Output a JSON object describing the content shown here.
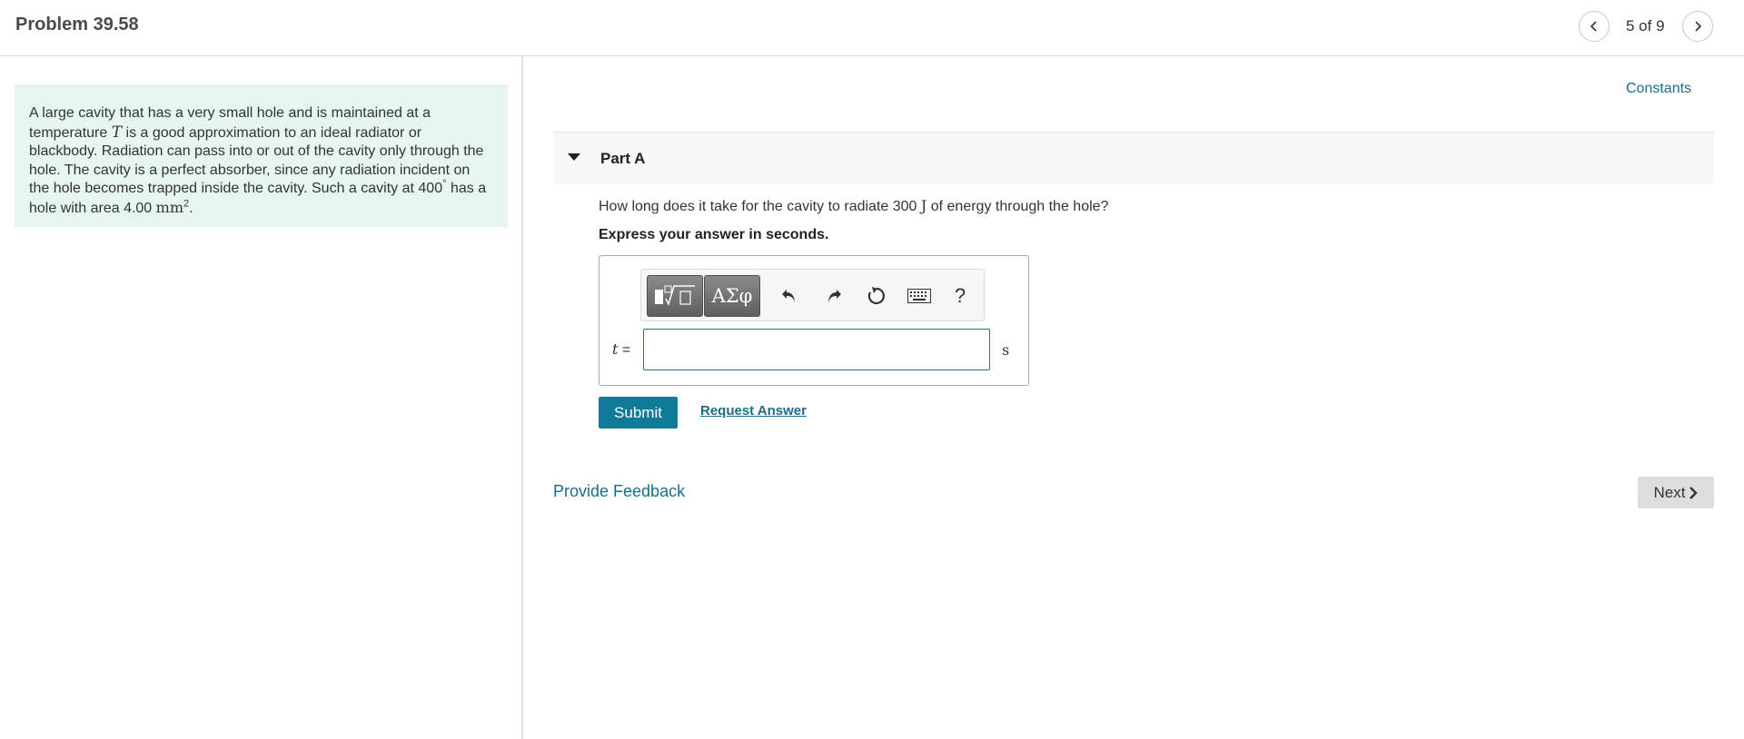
{
  "header": {
    "title": "Problem 39.58",
    "page_counter": "5 of 9",
    "prev_icon": "chevron-left-icon",
    "next_icon": "chevron-right-icon"
  },
  "intro": {
    "text_1": "A large cavity that has a very small hole and is maintained at a temperature ",
    "var_T": "T",
    "text_2": " is a good approximation to an ideal radiator or blackbody. Radiation can pass into or out of the cavity only through the hole. The cavity is a perfect absorber, since any radiation incident on the hole becomes trapped inside the cavity. Such a cavity at 400",
    "degree": "°",
    "text_3": " has a hole with area 4.00 ",
    "area_unit": "mm",
    "area_exp": "2",
    "text_4": "."
  },
  "constants_link": "Constants",
  "part": {
    "title": "Part A",
    "question_1": "How long does it take for the cavity to radiate 300 ",
    "question_unit": "J",
    "question_2": " of energy through the hole?",
    "instruction": "Express your answer in seconds."
  },
  "answer": {
    "variable": "t",
    "equals": " =",
    "value": "",
    "unit": "s"
  },
  "toolbar": {
    "greek_label": "ΑΣφ",
    "help_label": "?",
    "icons": [
      "templates-icon",
      "greek-letters-icon",
      "undo-icon",
      "redo-icon",
      "reset-icon",
      "keyboard-icon",
      "help-icon"
    ]
  },
  "buttons": {
    "submit": "Submit",
    "request_answer": "Request Answer",
    "provide_feedback": "Provide Feedback",
    "next": "Next"
  },
  "colors": {
    "accent": "#0e7c98",
    "link": "#1a6d87",
    "intro_bg": "#e6f4f4"
  }
}
